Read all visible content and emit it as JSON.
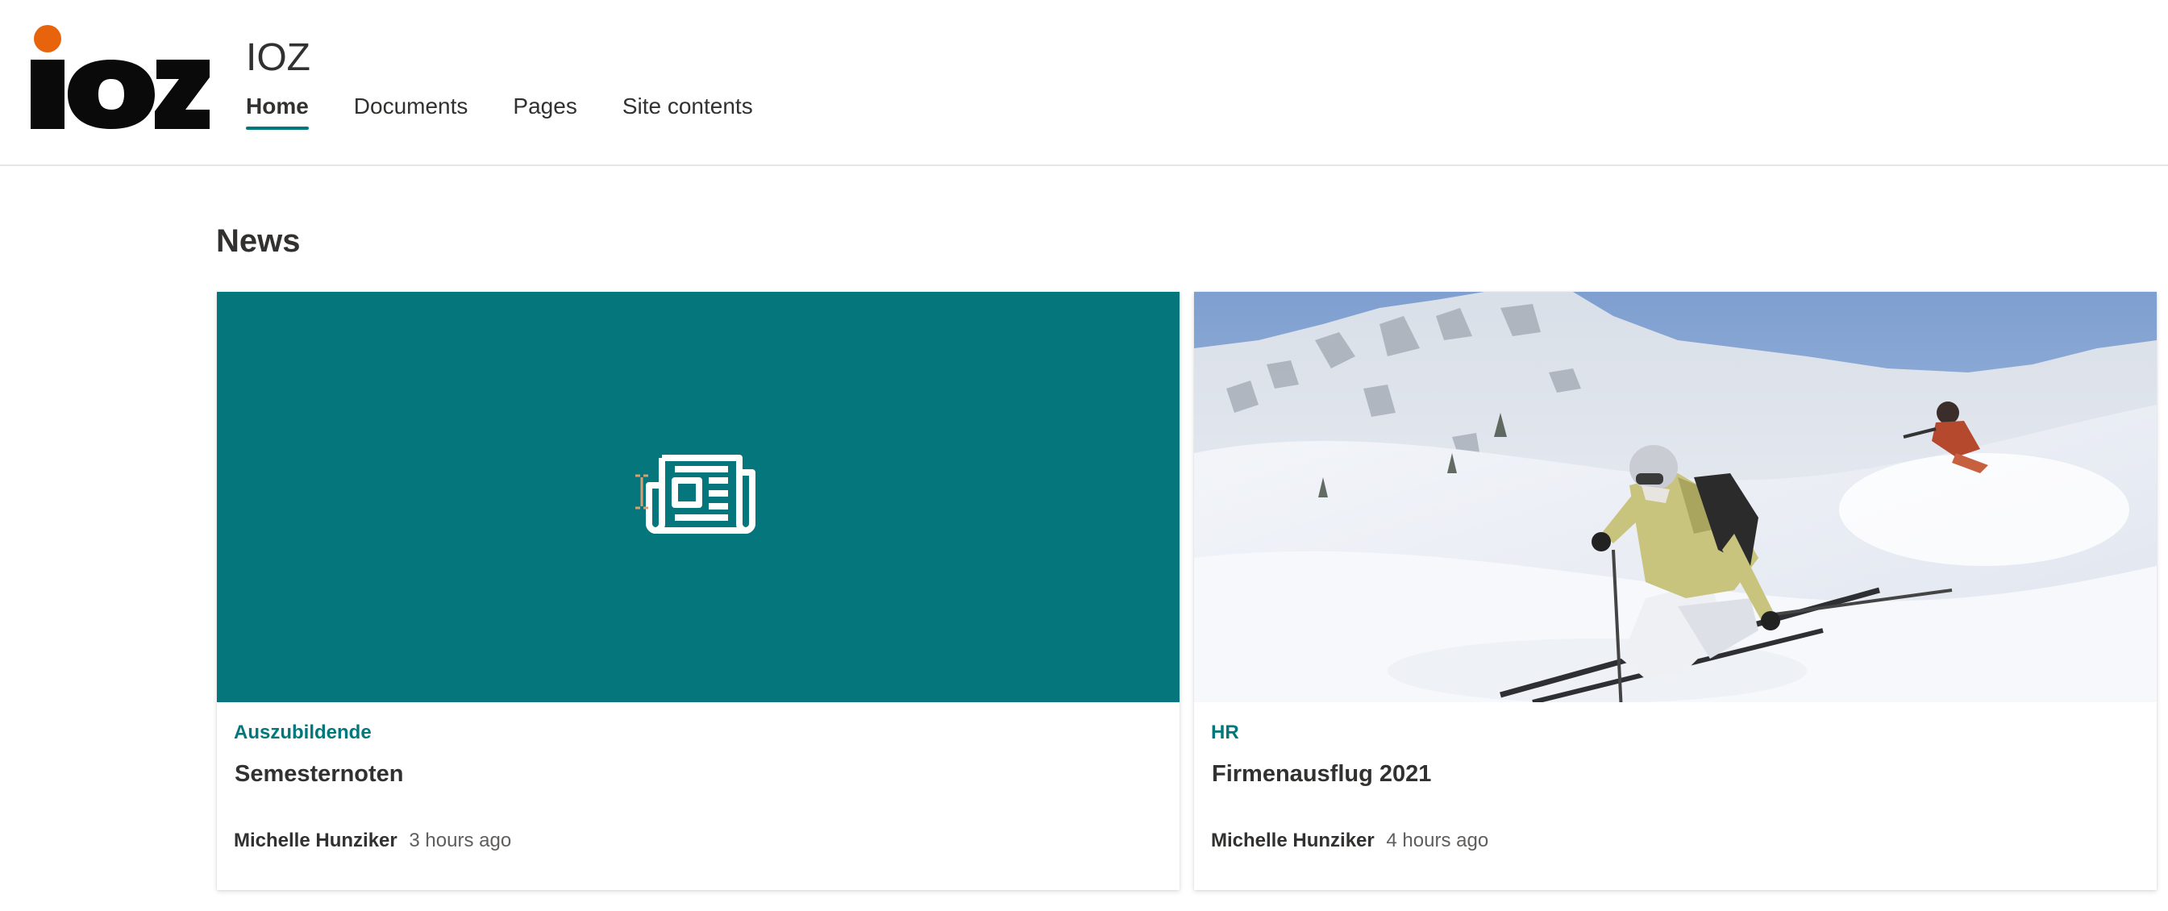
{
  "site": {
    "logo_text": "IOZ",
    "title": "IOZ"
  },
  "nav": {
    "items": [
      {
        "label": "Home",
        "active": true
      },
      {
        "label": "Documents",
        "active": false
      },
      {
        "label": "Pages",
        "active": false
      },
      {
        "label": "Site contents",
        "active": false
      }
    ]
  },
  "news": {
    "heading": "News",
    "cards": [
      {
        "image": "news-placeholder-icon",
        "image_bg": "#05777c",
        "topic": "Auszubildende",
        "title": "Semesternoten",
        "author": "Michelle Hunziker",
        "time": "3 hours ago"
      },
      {
        "image": "skiers-photo",
        "topic": "HR",
        "title": "Firmenausflug 2021",
        "author": "Michelle Hunziker",
        "time": "4 hours ago"
      }
    ]
  },
  "colors": {
    "accent": "#03787c",
    "logo_dot": "#e8640c",
    "text": "#323130",
    "muted": "#605e5c"
  }
}
